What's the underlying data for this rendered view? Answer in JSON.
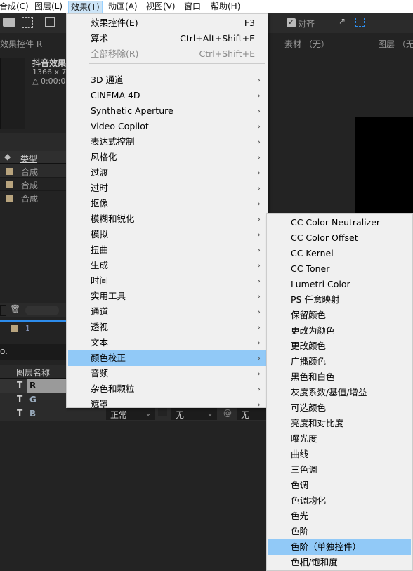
{
  "menubar": [
    {
      "label": "合成(C)"
    },
    {
      "label": "图层(L)"
    },
    {
      "label": "效果(T)"
    },
    {
      "label": "动画(A)"
    },
    {
      "label": "视图(V)"
    },
    {
      "label": "窗口"
    },
    {
      "label": "帮助(H)"
    }
  ],
  "toolbar": {
    "snap_label": "对齐"
  },
  "panels": {
    "effect_controls": "效果控件 R",
    "footage": "素材 （无）",
    "layer": "图层 （无",
    "comp_name": "抖音效果",
    "comp_size": "1366 x 76",
    "comp_time": "△ 0:00:0",
    "type_header": "类型",
    "items": [
      "合成",
      "合成",
      "合成"
    ],
    "timeline_num": "1",
    "layer_name_header": "图层名称",
    "layers": [
      "R",
      "G",
      "B"
    ],
    "mode": "正常",
    "trkmat": "无",
    "parent": "无"
  },
  "effects_menu": {
    "items": [
      {
        "label": "效果控件(E)",
        "shortcut": "F3"
      },
      {
        "label": "算术",
        "shortcut": "Ctrl+Alt+Shift+E"
      },
      {
        "label": "全部移除(R)",
        "shortcut": "Ctrl+Shift+E",
        "disabled": true
      },
      {
        "label": "3D 通道"
      },
      {
        "label": "CINEMA 4D"
      },
      {
        "label": "Synthetic Aperture"
      },
      {
        "label": "Video Copilot"
      },
      {
        "label": "表达式控制"
      },
      {
        "label": "风格化"
      },
      {
        "label": "过渡"
      },
      {
        "label": "过时"
      },
      {
        "label": "抠像"
      },
      {
        "label": "模糊和锐化"
      },
      {
        "label": "模拟"
      },
      {
        "label": "扭曲"
      },
      {
        "label": "生成"
      },
      {
        "label": "时间"
      },
      {
        "label": "实用工具"
      },
      {
        "label": "通道"
      },
      {
        "label": "透视"
      },
      {
        "label": "文本"
      },
      {
        "label": "颜色校正"
      },
      {
        "label": "音频"
      },
      {
        "label": "杂色和颗粒"
      },
      {
        "label": "遮罩"
      }
    ]
  },
  "color_correction_submenu": {
    "items": [
      "CC Color Neutralizer",
      "CC Color Offset",
      "CC Kernel",
      "CC Toner",
      "Lumetri Color",
      "PS 任意映射",
      "保留颜色",
      "更改为颜色",
      "更改颜色",
      "广播颜色",
      "黑色和白色",
      "灰度系数/基值/增益",
      "可选颜色",
      "亮度和对比度",
      "曝光度",
      "曲线",
      "三色调",
      "色调",
      "色调均化",
      "色光",
      "色阶",
      "色阶（单独控件）",
      "色相/饱和度"
    ],
    "highlighted": "色阶（单独控件）"
  },
  "colors": {
    "highlight": "#91c9f7",
    "menu_bg": "#f0f0f0",
    "swatch": "#b8a47e"
  }
}
